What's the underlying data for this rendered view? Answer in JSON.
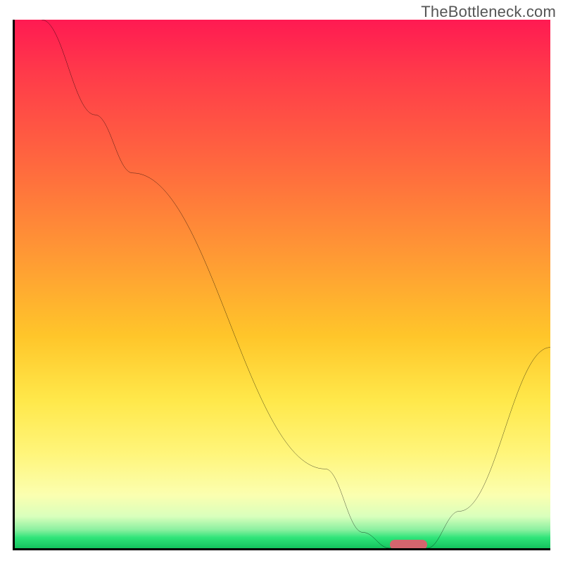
{
  "watermark": "TheBottleneck.com",
  "colors": {
    "top": "#ff1a52",
    "mid": "#ffe84a",
    "bottom": "#14c35e",
    "curve": "#000000",
    "marker": "#d4656e",
    "axis": "#000000"
  },
  "chart_data": {
    "type": "line",
    "title": "",
    "xlabel": "",
    "ylabel": "",
    "xlim": [
      0,
      100
    ],
    "ylim": [
      0,
      100
    ],
    "grid": false,
    "legend": false,
    "curve": [
      {
        "x": 5,
        "y": 100
      },
      {
        "x": 15,
        "y": 82
      },
      {
        "x": 22,
        "y": 71
      },
      {
        "x": 58,
        "y": 15
      },
      {
        "x": 65,
        "y": 3
      },
      {
        "x": 70,
        "y": 0
      },
      {
        "x": 77,
        "y": 0
      },
      {
        "x": 83,
        "y": 7
      },
      {
        "x": 100,
        "y": 38
      }
    ],
    "optimal_range": {
      "start": 70,
      "end": 77
    }
  }
}
